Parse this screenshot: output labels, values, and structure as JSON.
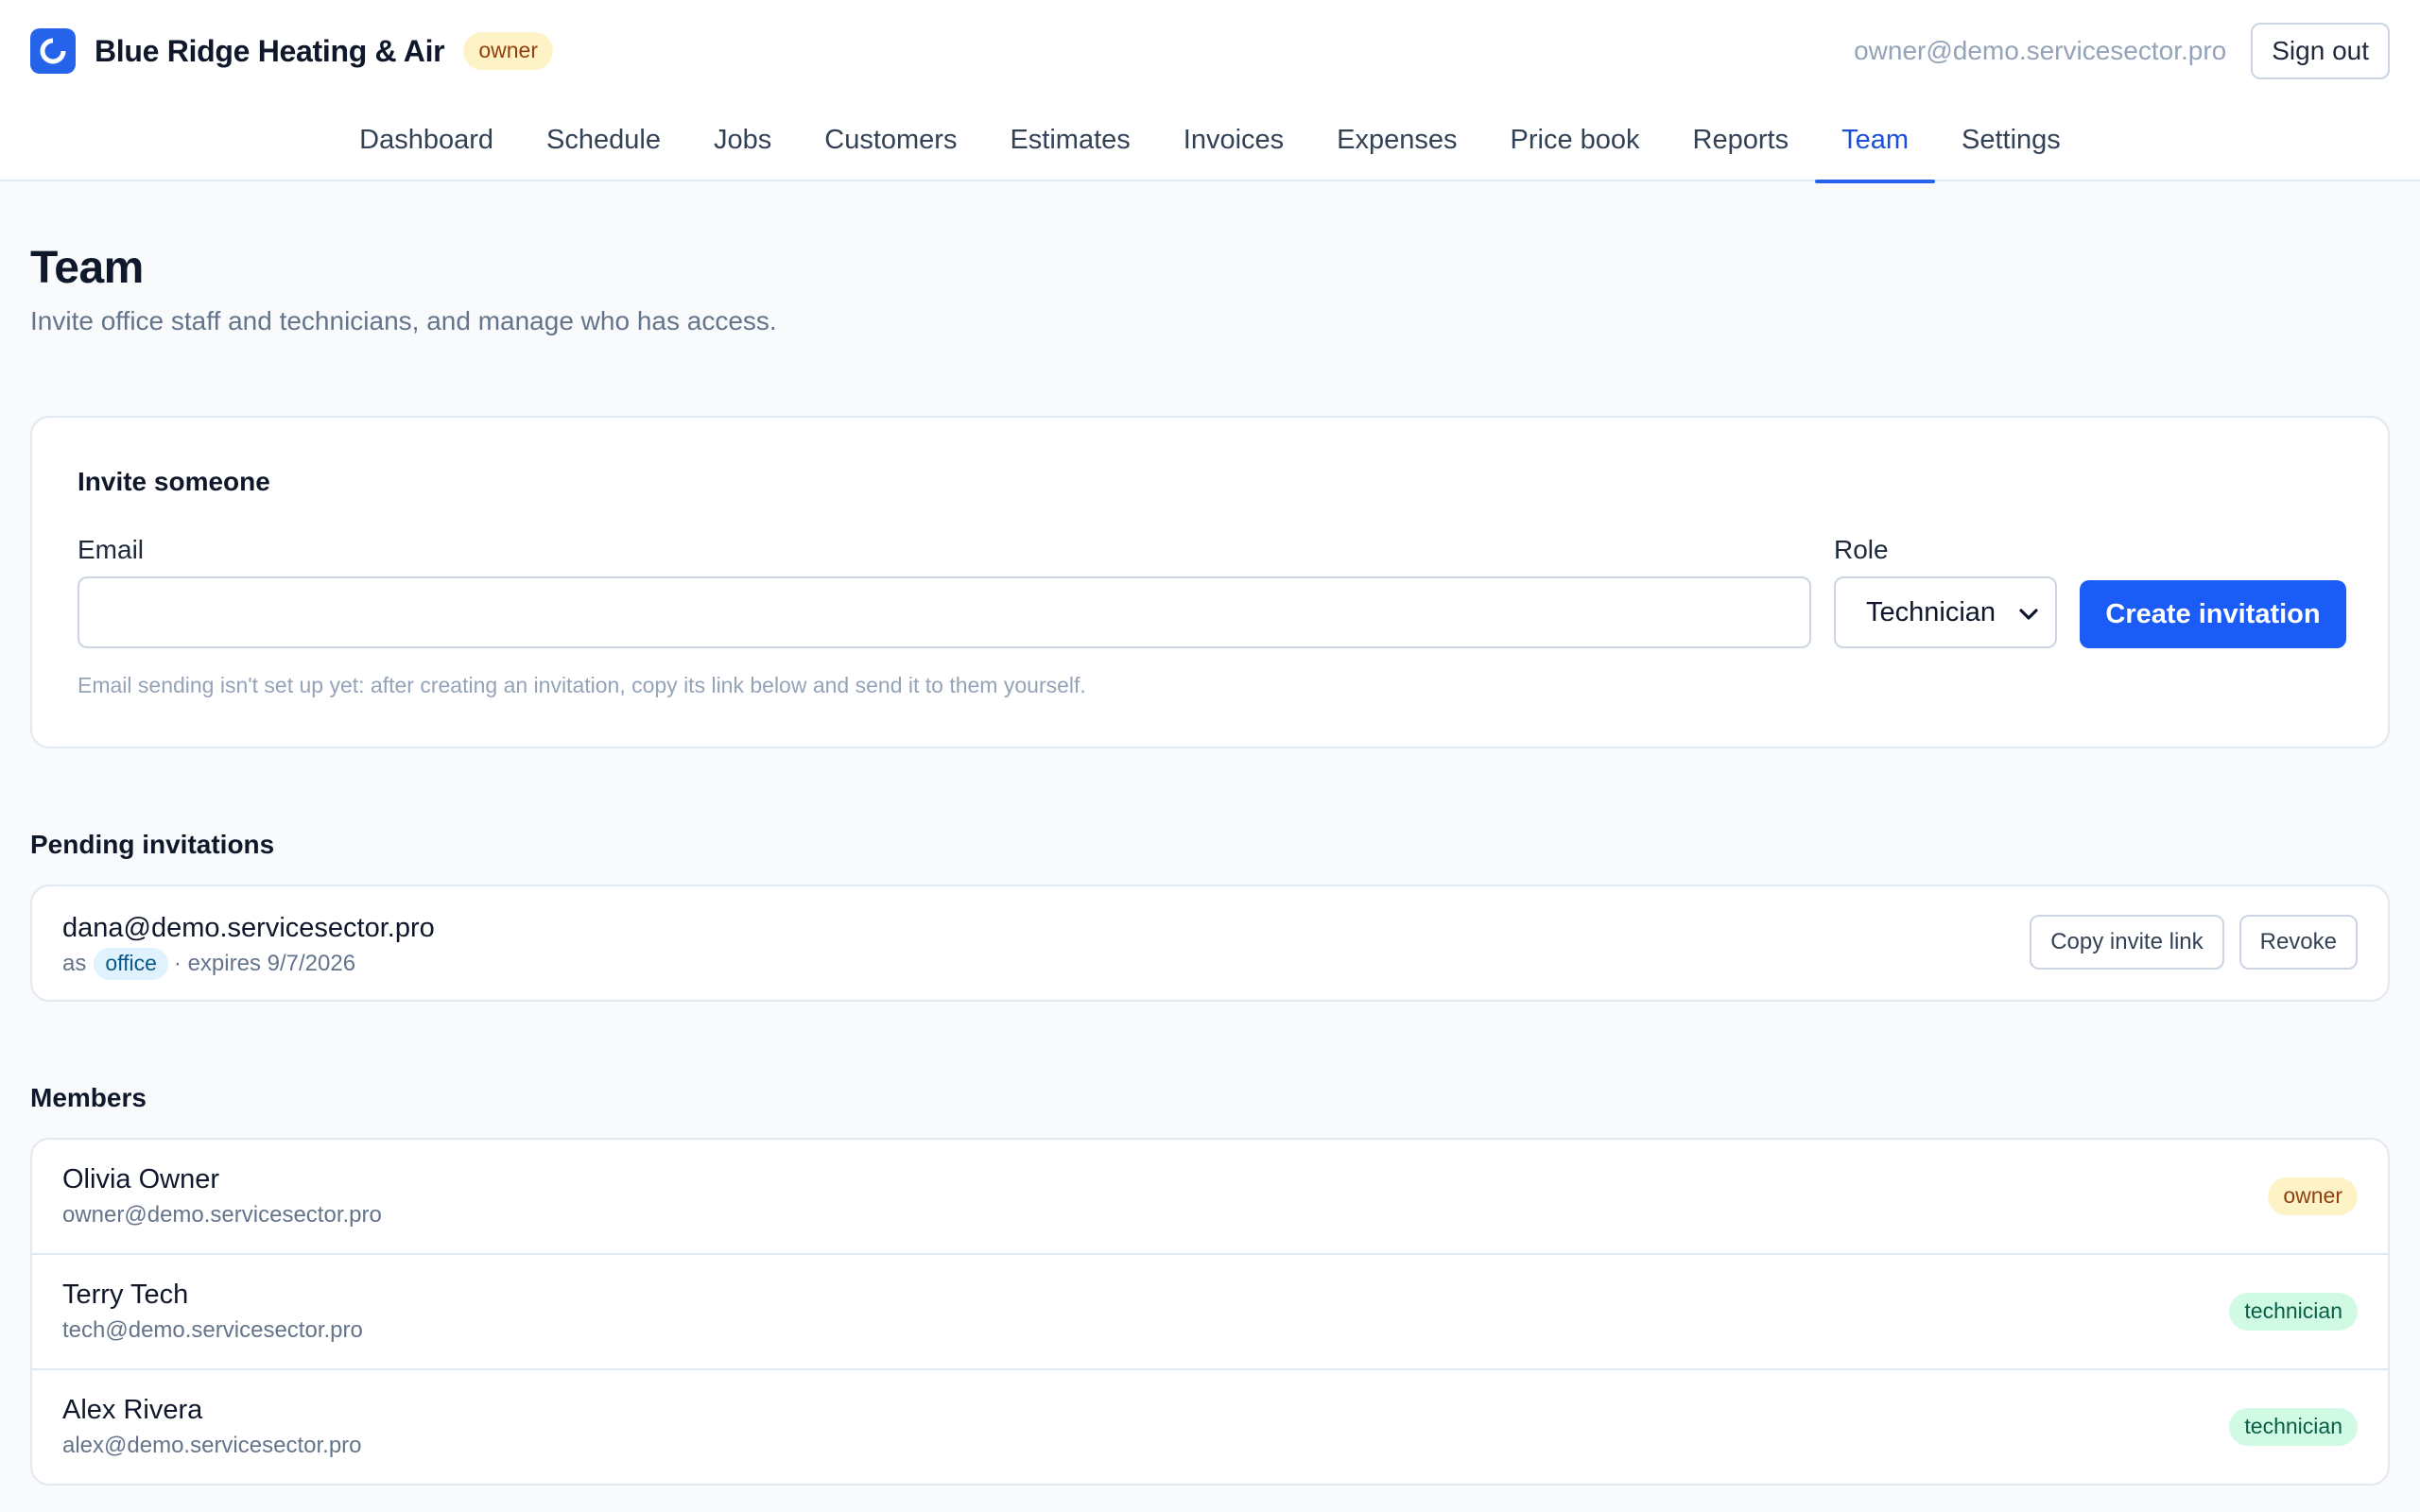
{
  "header": {
    "business_name": "Blue Ridge Heating & Air",
    "role_badge": "owner",
    "user_email": "owner@demo.servicesector.pro",
    "sign_out_label": "Sign out",
    "logo_icon": "logo-ring-icon",
    "brand_color": "#2563eb"
  },
  "nav": {
    "items": [
      {
        "label": "Dashboard"
      },
      {
        "label": "Schedule"
      },
      {
        "label": "Jobs"
      },
      {
        "label": "Customers"
      },
      {
        "label": "Estimates"
      },
      {
        "label": "Invoices"
      },
      {
        "label": "Expenses"
      },
      {
        "label": "Price book"
      },
      {
        "label": "Reports"
      },
      {
        "label": "Team"
      },
      {
        "label": "Settings"
      }
    ],
    "active": "Team"
  },
  "page": {
    "title": "Team",
    "subtitle": "Invite office staff and technicians, and manage who has access."
  },
  "invite": {
    "title": "Invite someone",
    "email_label": "Email",
    "email_value": "",
    "email_placeholder": "",
    "role_label": "Role",
    "role_selected": "Technician",
    "create_label": "Create invitation",
    "note": "Email sending isn't set up yet: after creating an invitation, copy its link below and send it to them yourself."
  },
  "pending": {
    "title": "Pending invitations",
    "items": [
      {
        "email": "dana@demo.servicesector.pro",
        "as_label": "as",
        "role": "office",
        "expires": "· expires 9/7/2026",
        "copy_label": "Copy invite link",
        "revoke_label": "Revoke"
      }
    ]
  },
  "members": {
    "title": "Members",
    "items": [
      {
        "name": "Olivia Owner",
        "email": "owner@demo.servicesector.pro",
        "role": "owner"
      },
      {
        "name": "Terry Tech",
        "email": "tech@demo.servicesector.pro",
        "role": "technician"
      },
      {
        "name": "Alex Rivera",
        "email": "alex@demo.servicesector.pro",
        "role": "technician"
      }
    ]
  }
}
